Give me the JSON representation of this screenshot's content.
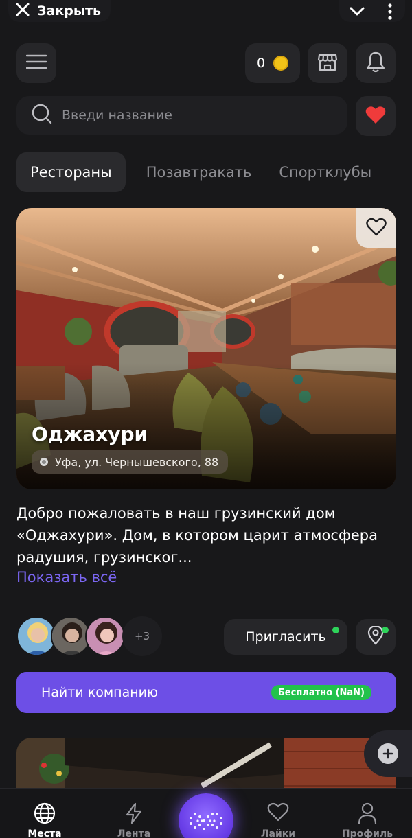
{
  "topbar": {
    "close_label": "Закрыть"
  },
  "header": {
    "coins": "0"
  },
  "search": {
    "placeholder": "Введи название"
  },
  "tabs": [
    {
      "label": "Рестораны",
      "active": true
    },
    {
      "label": "Позавтракать",
      "active": false
    },
    {
      "label": "Спортклубы",
      "active": false
    }
  ],
  "card": {
    "title": "Оджахури",
    "address": "Уфа, ул. Чернышевского, 88",
    "description": "Добро пожаловать в наш грузинский дом «Оджахури». Дом, в котором царит атмосфера радушия, грузинског...",
    "show_all": "Показать всё"
  },
  "social": {
    "more_count": "+3",
    "invite_label": "Пригласить"
  },
  "find": {
    "label": "Найти компанию",
    "badge": "Бесплатно (NaN)"
  },
  "nav": [
    {
      "label": "Места",
      "icon": "globe-icon",
      "active": true
    },
    {
      "label": "Лента",
      "icon": "lightning-icon",
      "active": false
    },
    {
      "label": "Лайки",
      "icon": "heart-icon",
      "active": false
    },
    {
      "label": "Профиль",
      "icon": "profile-icon",
      "active": false
    }
  ],
  "colors": {
    "accent": "#6d4fe6",
    "link": "#7b66f2",
    "success": "#22c24b",
    "like": "#ef3b3b",
    "coin": "#f2c318"
  }
}
